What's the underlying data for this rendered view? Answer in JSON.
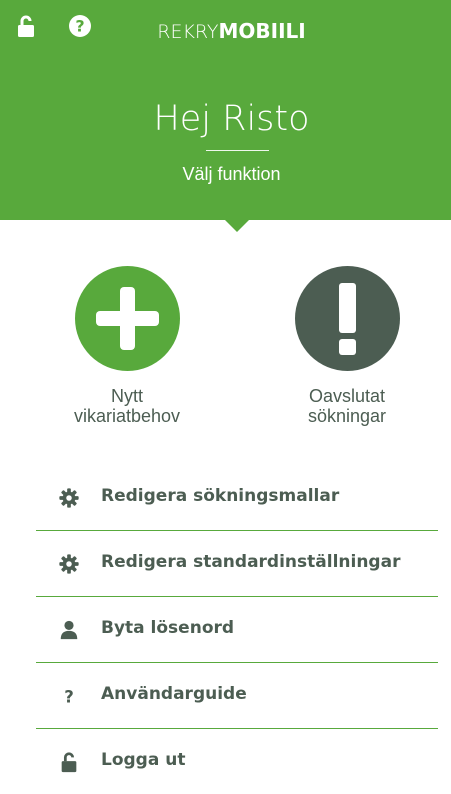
{
  "header": {
    "logo_light": "REKRY",
    "logo_bold": "MOBIILI",
    "greeting": "Hej Risto",
    "subtitle": "Välj funktion",
    "lock_icon": "unlock-icon",
    "help_icon": "help-icon"
  },
  "actions": [
    {
      "line1": "Nytt",
      "line2": "vikariatbehov",
      "icon": "plus-icon",
      "color": "#58a93c"
    },
    {
      "line1": "Oavslutat",
      "line2": "sökningar",
      "icon": "exclamation-icon",
      "color": "#4c5d52"
    }
  ],
  "menu": {
    "items": [
      {
        "label": "Redigera sökningsmallar",
        "icon": "gear-icon"
      },
      {
        "label": "Redigera standardinställningar",
        "icon": "gear-icon"
      },
      {
        "label": "Byta lösenord",
        "icon": "user-icon"
      },
      {
        "label": "Användarguide",
        "icon": "question-icon"
      },
      {
        "label": "Logga ut",
        "icon": "unlock-icon"
      }
    ]
  },
  "colors": {
    "brand_green": "#58a93c",
    "dark_gray_green": "#4c5d52",
    "background": "#ffffff"
  }
}
